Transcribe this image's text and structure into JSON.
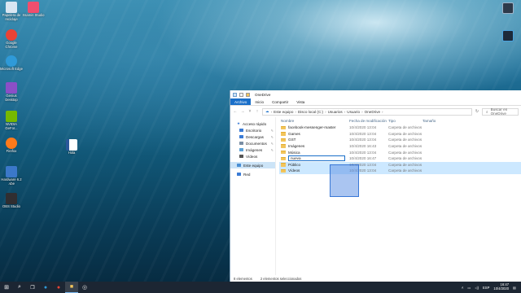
{
  "desktop": {
    "icons_left": [
      {
        "label": "Papelera de reciclaje",
        "icon": "recycle-bin-icon",
        "color": "#d9e6f2"
      },
      {
        "label": "Google Chrome",
        "icon": "chrome-icon",
        "color": "#e94335"
      },
      {
        "label": "Microsoft Edge",
        "icon": "edge-icon",
        "color": "#2f9ad8"
      },
      {
        "label": "Genius Desktop",
        "icon": "genius-icon",
        "color": "#8b4fc7"
      },
      {
        "label": "NVIDIA GeFor...",
        "icon": "nvidia-icon",
        "color": "#76b900"
      },
      {
        "label": "Firefox",
        "icon": "firefox-icon",
        "color": "#ff7a1a"
      },
      {
        "label": "Hardware 6.2 .vbe",
        "icon": "script-icon",
        "color": "#3b78c9"
      },
      {
        "label": "OBS Studio",
        "icon": "obs-icon",
        "color": "#302e31"
      }
    ],
    "icon_xamin": {
      "label": "Xsamin Studio",
      "icon": "xsamin-icon",
      "color": "#f04e6e"
    },
    "icon_word": {
      "label": "Hola",
      "icon": "word-doc-icon",
      "color": "#2b579a"
    },
    "icons_right": [
      {
        "label": "",
        "icon": "app-icon-1",
        "color": "#2d3a4a"
      },
      {
        "label": "",
        "icon": "app-icon-2",
        "color": "#1d2a3a"
      }
    ]
  },
  "explorer": {
    "title": "OneDrive",
    "ribbon_tabs": [
      "Archivo",
      "Inicio",
      "Compartir",
      "Vista"
    ],
    "breadcrumb": [
      "Este equipo",
      "Disco local (C:)",
      "Usuarios",
      "Usuario",
      "OneDrive"
    ],
    "search_placeholder": "Buscar en OneDrive",
    "nav": {
      "quick_access": "Acceso rápido",
      "quick_items": [
        {
          "label": "Escritorio",
          "icon": "desktop-folder-icon",
          "color": "#3a7bd5"
        },
        {
          "label": "Descargas",
          "icon": "downloads-icon",
          "color": "#3a7bd5"
        },
        {
          "label": "Documentos",
          "icon": "documents-icon",
          "color": "#7a8ea4"
        },
        {
          "label": "Imágenes",
          "icon": "pictures-icon",
          "color": "#5ba0d6"
        },
        {
          "label": "Vídeos",
          "icon": "videos-icon",
          "color": "#555"
        }
      ],
      "this_pc": "Este equipo",
      "network": "Red"
    },
    "columns": [
      "Nombre",
      "Fecha de modificación",
      "Tipo",
      "Tamaño"
    ],
    "rows": [
      {
        "name": "facebook-messenger-master",
        "date": "10/4/2020 13:04",
        "type": "Carpeta de archivos"
      },
      {
        "name": "Games",
        "date": "10/4/2020 13:04",
        "type": "Carpeta de archivos"
      },
      {
        "name": "GST",
        "date": "10/4/2020 13:04",
        "type": "Carpeta de archivos"
      },
      {
        "name": "Imágenes",
        "date": "10/4/2020 16:43",
        "type": "Carpeta de archivos"
      },
      {
        "name": "Música",
        "date": "10/4/2020 13:04",
        "type": "Carpeta de archivos"
      },
      {
        "name": "nueva",
        "date": "10/4/2020 16:47",
        "type": "Carpeta de archivos"
      },
      {
        "name": "Público",
        "date": "10/4/2020 13:04",
        "type": "Carpeta de archivos"
      },
      {
        "name": "Vídeos",
        "date": "10/4/2020 13:04",
        "type": "Carpeta de archivos"
      }
    ],
    "status_count": "8 elementos",
    "status_selected": "2 elementos seleccionados"
  },
  "taskbar": {
    "lang": "ESP",
    "time": "16:47",
    "date": "10/4/2020"
  }
}
